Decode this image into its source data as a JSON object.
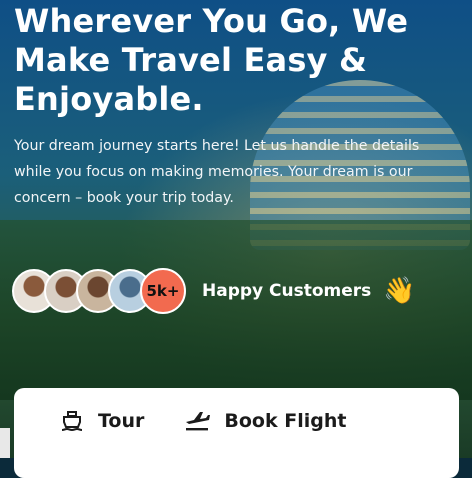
{
  "hero": {
    "headline": "Wherever You Go, We\nMake Travel Easy &\nEnjoyable.",
    "subtext": "Your dream journey starts here! Let us handle the details\nwhile you focus on making memories. Your dream is our\nconcern – book your trip today."
  },
  "customers": {
    "count_badge": "5k+",
    "label": "Happy Customers",
    "emoji": "👋"
  },
  "search": {
    "tabs": [
      {
        "label": "Tour",
        "icon": "ship-icon"
      },
      {
        "label": "Book Flight",
        "icon": "plane-icon"
      }
    ]
  },
  "colors": {
    "badge": "#f26a4f",
    "card": "#ffffff",
    "text_light": "#ffffff"
  }
}
